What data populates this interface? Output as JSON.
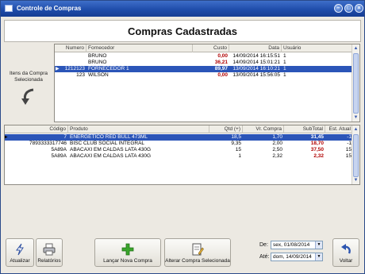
{
  "window": {
    "title": "Controle de Compras"
  },
  "heading": "Compras Cadastradas",
  "side_panel": {
    "label": "Itens da Compra Selecionada"
  },
  "purchases": {
    "columns": [
      "Numero",
      "Fornecedor",
      "Custo",
      "Data",
      "Usuário"
    ],
    "rows": [
      {
        "numero": "",
        "fornecedor": "BRUNO",
        "custo": "0,00",
        "data": "14/09/2014 16:15:51",
        "usuario": "1",
        "selected": false
      },
      {
        "numero": "",
        "fornecedor": "BRUNO",
        "custo": "36,21",
        "data": "14/09/2014 15:01:21",
        "usuario": "1",
        "selected": false
      },
      {
        "numero": "1212123",
        "fornecedor": "FORNECEDOR 1",
        "custo": "89,97",
        "data": "13/09/2014 16:10:21",
        "usuario": "1",
        "selected": true
      },
      {
        "numero": "123",
        "fornecedor": "WILSON",
        "custo": "0,00",
        "data": "13/09/2014 15:56:05",
        "usuario": "1",
        "selected": false
      }
    ]
  },
  "items": {
    "columns": [
      "Código",
      "Produto",
      "Qtd (+)",
      "Vr. Compra",
      "SubTotal",
      "Est. Atual"
    ],
    "rows": [
      {
        "codigo": "7",
        "produto": "ENERGÉTICO RED BULL 473ML",
        "qtd": "18,5",
        "vr_compra": "1,70",
        "subtotal": "31,45",
        "est_atual": "-1",
        "selected": true
      },
      {
        "codigo": "7893333317746",
        "produto": "BISC CLUB SOCIAL INTEGRAL",
        "qtd": "9,35",
        "vr_compra": "2,00",
        "subtotal": "18,70",
        "est_atual": "-1",
        "selected": false
      },
      {
        "codigo": "5A89A",
        "produto": "ABACAXI EM CALDAS LATA 430G",
        "qtd": "15",
        "vr_compra": "2,50",
        "subtotal": "37,50",
        "est_atual": "15",
        "selected": false
      },
      {
        "codigo": "5A89A",
        "produto": "ABACAXI EM CALDAS LATA 430G",
        "qtd": "1",
        "vr_compra": "2,32",
        "subtotal": "2,32",
        "est_atual": "15",
        "selected": false
      }
    ]
  },
  "toolbar": {
    "atualizar": "Atualizar",
    "relatorios": "Relatórios",
    "lancar": "Lançar Nova Compra",
    "alterar": "Alterar Compra Selecionada",
    "voltar": "Voltar",
    "de_label": "De:",
    "ate_label": "Até:",
    "de_value": "sex, 01/08/2014",
    "ate_value": "dom, 14/09/2014"
  },
  "colors": {
    "selection": "#2b55b8",
    "negative_value": "#b00000",
    "titlebar": "#1d4aa8"
  }
}
